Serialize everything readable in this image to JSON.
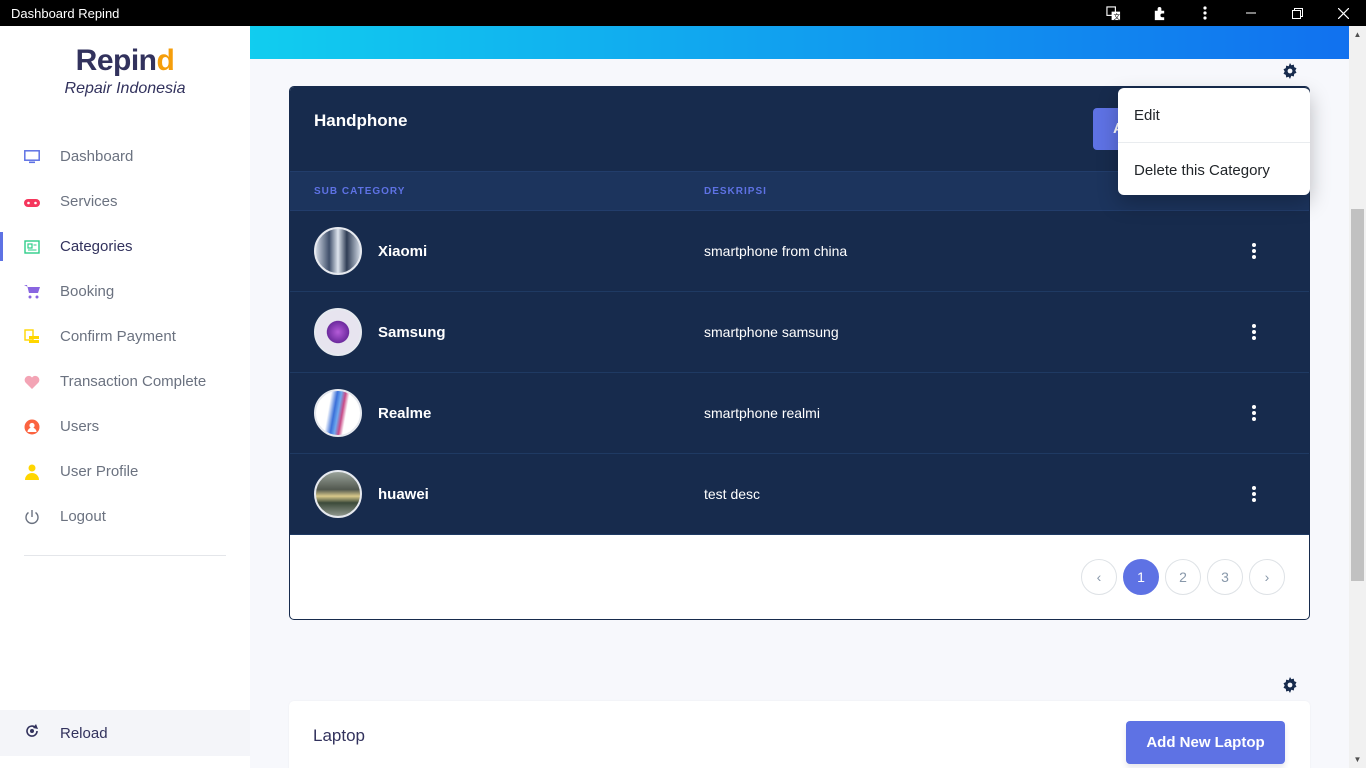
{
  "window": {
    "title": "Dashboard Repind"
  },
  "brand": {
    "name_main": "Repin",
    "name_accent": "d",
    "subtitle": "Repair Indonesia"
  },
  "sidebar": {
    "items": [
      {
        "label": "Dashboard",
        "icon": "monitor-icon",
        "color": "#5e72e4"
      },
      {
        "label": "Services",
        "icon": "gamepad-icon",
        "color": "#f5365c"
      },
      {
        "label": "Categories",
        "icon": "category-icon",
        "color": "#2dce89",
        "active": true
      },
      {
        "label": "Booking",
        "icon": "cart-icon",
        "color": "#8965e0"
      },
      {
        "label": "Confirm Payment",
        "icon": "coins-icon",
        "color": "#ffd600"
      },
      {
        "label": "Transaction Complete",
        "icon": "heart-icon",
        "color": "#f3a4b5"
      },
      {
        "label": "Users",
        "icon": "user-circle-icon",
        "color": "#fb6340"
      },
      {
        "label": "User Profile",
        "icon": "user-icon",
        "color": "#ffd600"
      },
      {
        "label": "Logout",
        "icon": "power-icon",
        "color": "#6b7280"
      }
    ],
    "reload_label": "Reload"
  },
  "category": {
    "title": "Handphone",
    "add_button_partial": "A",
    "columns": [
      "SUB CATEGORY",
      "DESKRIPSI"
    ],
    "rows": [
      {
        "name": "Xiaomi",
        "desc": "smartphone from china"
      },
      {
        "name": "Samsung",
        "desc": "smartphone samsung"
      },
      {
        "name": "Realme",
        "desc": "smartphone realmi"
      },
      {
        "name": "huawei",
        "desc": "test desc"
      }
    ],
    "pagination": {
      "pages": [
        "1",
        "2",
        "3"
      ],
      "current": "1",
      "prev": "‹",
      "next": "›"
    }
  },
  "dropdown": {
    "items": [
      "Edit",
      "Delete this Category"
    ]
  },
  "laptop": {
    "title": "Laptop",
    "button": "Add New Laptop"
  },
  "colors": {
    "primary": "#5e72e4",
    "dark": "#172b4d"
  }
}
